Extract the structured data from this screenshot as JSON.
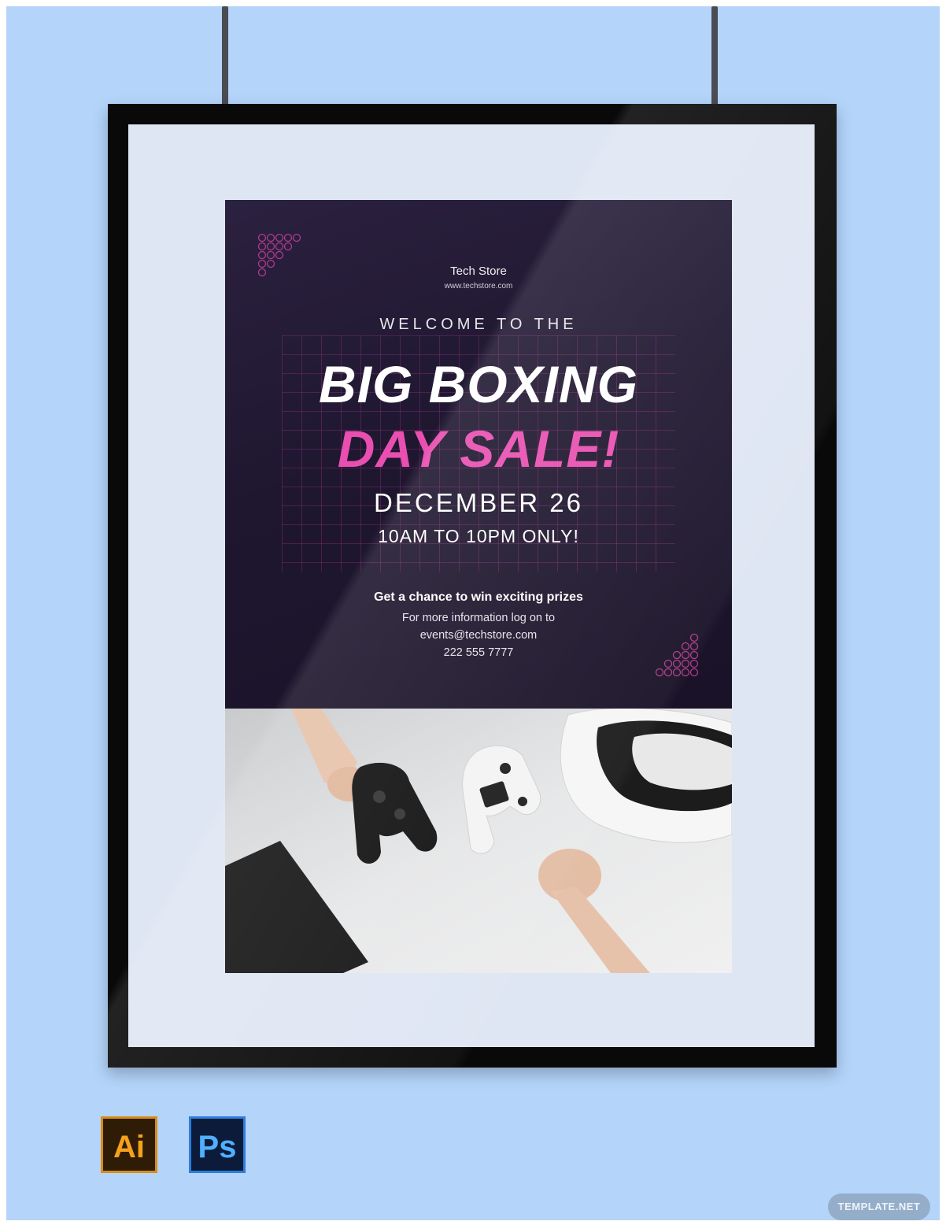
{
  "poster": {
    "store_name": "Tech Store",
    "store_url": "www.techstore.com",
    "welcome": "WELCOME TO THE",
    "headline_line1": "BIG BOXING",
    "headline_line2": "DAY SALE!",
    "date": "DECEMBER 26",
    "time": "10AM TO 10PM ONLY!",
    "prize": "Get a chance to win exciting prizes",
    "info_line1": "For more information log on to",
    "info_line2": "events@techstore.com",
    "phone": "222 555 7777"
  },
  "icons": {
    "illustrator": "Ai",
    "photoshop": "Ps"
  },
  "watermark": "TEMPLATE.NET",
  "colors": {
    "background": "#b4d4fa",
    "poster_dark": "#1f1730",
    "accent_pink": "#e84fb0",
    "frame": "#090909",
    "mat": "#dfe6f3"
  }
}
